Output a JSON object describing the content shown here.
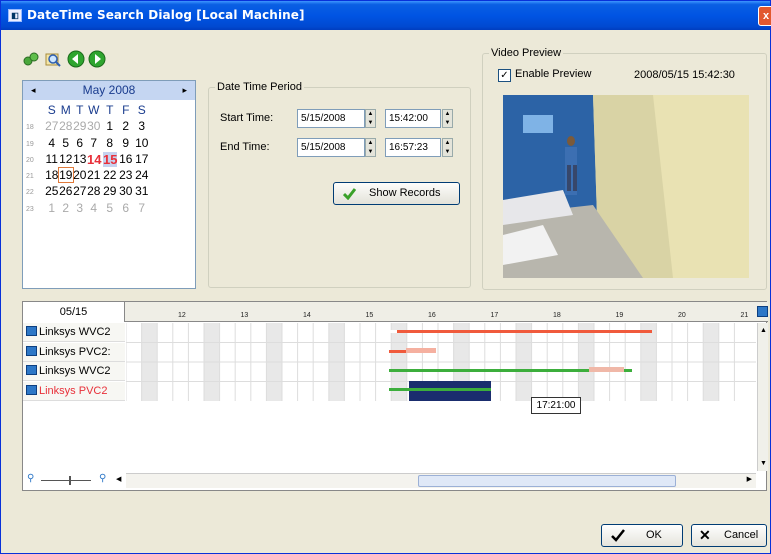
{
  "window": {
    "title": "DateTime Search Dialog  [Local Machine]",
    "close_glyph": "x"
  },
  "toolbar": {
    "icons": [
      "connect-icon",
      "search-icon",
      "back-arrow-icon",
      "forward-arrow-icon"
    ]
  },
  "calendar": {
    "month_label": "May 2008",
    "prev_arrow": "◂",
    "next_arrow": "▸",
    "day_names": [
      "S",
      "M",
      "T",
      "W",
      "T",
      "F",
      "S"
    ],
    "weeks": [
      {
        "wk": "18",
        "days": [
          "27",
          "28",
          "29",
          "30",
          "1",
          "2",
          "3"
        ]
      },
      {
        "wk": "19",
        "days": [
          "4",
          "5",
          "6",
          "7",
          "8",
          "9",
          "10"
        ]
      },
      {
        "wk": "20",
        "days": [
          "11",
          "12",
          "13",
          "14",
          "15",
          "16",
          "17"
        ]
      },
      {
        "wk": "21",
        "days": [
          "18",
          "19",
          "20",
          "21",
          "22",
          "23",
          "24"
        ]
      },
      {
        "wk": "22",
        "days": [
          "25",
          "26",
          "27",
          "28",
          "29",
          "30",
          "31"
        ]
      },
      {
        "wk": "23",
        "days": [
          "1",
          "2",
          "3",
          "4",
          "5",
          "6",
          "7"
        ]
      }
    ]
  },
  "period": {
    "legend": "Date Time Period",
    "start_label": "Start Time:",
    "start_date": "5/15/2008",
    "start_time": "15:42:00",
    "end_label": "End Time:",
    "end_date": "5/15/2008",
    "end_time": "16:57:23",
    "show_button": "Show Records"
  },
  "preview": {
    "legend": "Video Preview",
    "enable_label": "Enable Preview",
    "enable_checked": true,
    "timestamp": "2008/05/15 15:42:30"
  },
  "timeline": {
    "date": "05/15",
    "hours": [
      "12",
      "13",
      "14",
      "15",
      "16",
      "17",
      "18",
      "19",
      "20",
      "21"
    ],
    "channels": [
      {
        "name": "Linksys WVC2",
        "active": false
      },
      {
        "name": "Linksys PVC2:",
        "active": false
      },
      {
        "name": "Linksys WVC2",
        "active": false
      },
      {
        "name": "Linksys PVC2",
        "active": true
      }
    ],
    "cursor_time": "17:21:00"
  },
  "buttons": {
    "ok": "OK",
    "cancel": "Cancel"
  },
  "colors": {
    "record_red": "#f05a3c",
    "record_green": "#3cae3c",
    "selection_blue": "#1a2d6e",
    "accent": "#0054e3"
  }
}
